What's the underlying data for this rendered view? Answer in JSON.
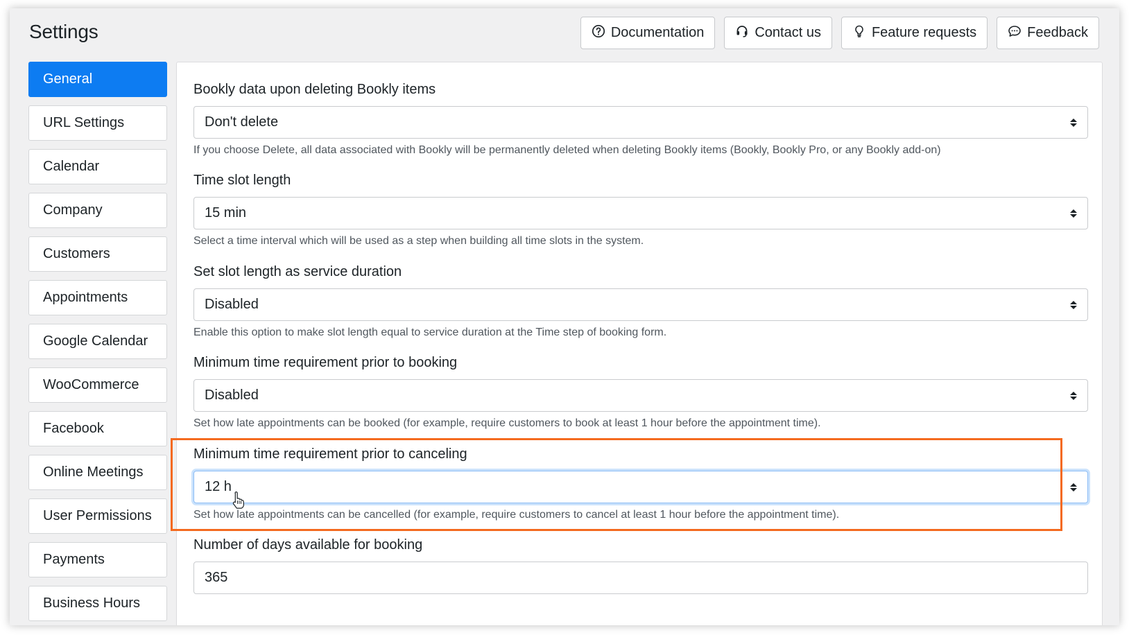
{
  "page": {
    "title": "Settings"
  },
  "top_buttons": [
    {
      "label": "Documentation",
      "icon": "question-circle-icon"
    },
    {
      "label": "Contact us",
      "icon": "headset-icon"
    },
    {
      "label": "Feature requests",
      "icon": "lightbulb-icon"
    },
    {
      "label": "Feedback",
      "icon": "chat-bubble-icon"
    }
  ],
  "sidebar": {
    "items": [
      {
        "label": "General",
        "active": true
      },
      {
        "label": "URL Settings"
      },
      {
        "label": "Calendar"
      },
      {
        "label": "Company"
      },
      {
        "label": "Customers"
      },
      {
        "label": "Appointments"
      },
      {
        "label": "Google Calendar"
      },
      {
        "label": "WooCommerce"
      },
      {
        "label": "Facebook"
      },
      {
        "label": "Online Meetings"
      },
      {
        "label": "User Permissions"
      },
      {
        "label": "Payments"
      },
      {
        "label": "Business Hours"
      }
    ]
  },
  "fields": [
    {
      "label": "Bookly data upon deleting Bookly items",
      "value": "Don't delete",
      "help": "If you choose Delete, all data associated with Bookly will be permanently deleted when deleting Bookly items (Bookly, Bookly Pro, or any Bookly add-on)"
    },
    {
      "label": "Time slot length",
      "value": "15 min",
      "help": "Select a time interval which will be used as a step when building all time slots in the system."
    },
    {
      "label": "Set slot length as service duration",
      "value": "Disabled",
      "help": "Enable this option to make slot length equal to service duration at the Time step of booking form."
    },
    {
      "label": "Minimum time requirement prior to booking",
      "value": "Disabled",
      "help": "Set how late appointments can be booked (for example, require customers to book at least 1 hour before the appointment time)."
    },
    {
      "label": "Minimum time requirement prior to canceling",
      "value": "12 h",
      "help": "Set how late appointments can be cancelled (for example, require customers to cancel at least 1 hour before the appointment time).",
      "focused": true
    },
    {
      "label": "Number of days available for booking",
      "value": "365"
    }
  ],
  "colors": {
    "accent": "#0d7cf2",
    "highlight": "#f46a1f",
    "background": "#f0f0f1"
  }
}
